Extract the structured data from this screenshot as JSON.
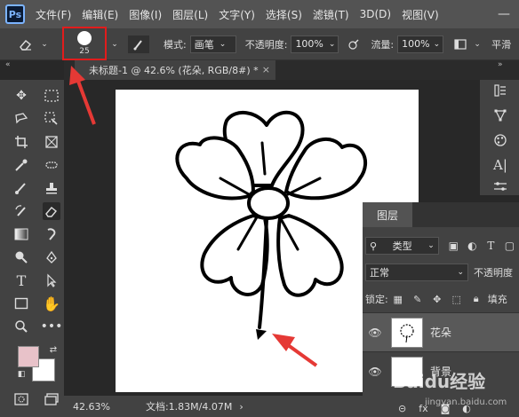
{
  "app": {
    "logo": "Ps"
  },
  "menu": [
    "文件(F)",
    "编辑(E)",
    "图像(I)",
    "图层(L)",
    "文字(Y)",
    "选择(S)",
    "滤镜(T)",
    "3D(D)",
    "视图(V)"
  ],
  "options_bar": {
    "brush_size": "25",
    "mode_label": "模式:",
    "mode_value": "画笔",
    "opacity_label": "不透明度:",
    "opacity_value": "100%",
    "flow_label": "流量:",
    "flow_value": "100%",
    "smooth_label": "平滑"
  },
  "document_tab": {
    "title": "未标题-1 @ 42.6% (花朵, RGB/8#) *",
    "close": "×"
  },
  "status_bar": {
    "zoom": "42.63%",
    "doc_info": "文档:1.83M/4.07M"
  },
  "colors": {
    "foreground": "#e8c2c9",
    "background": "#ffffff",
    "highlight": "#e11c1c"
  },
  "layers_panel": {
    "tab_label": "图层",
    "filter_label": "类型",
    "blend_mode": "正常",
    "opacity_label": "不透明度",
    "lock_label": "锁定:",
    "fill_label": "填充",
    "layers": [
      {
        "name": "花朵",
        "selected": true
      },
      {
        "name": "背景",
        "selected": false
      }
    ],
    "fx_label": "fx"
  },
  "watermark": {
    "text": "Baidu经验",
    "sub": "jingyan.baidu.com"
  }
}
